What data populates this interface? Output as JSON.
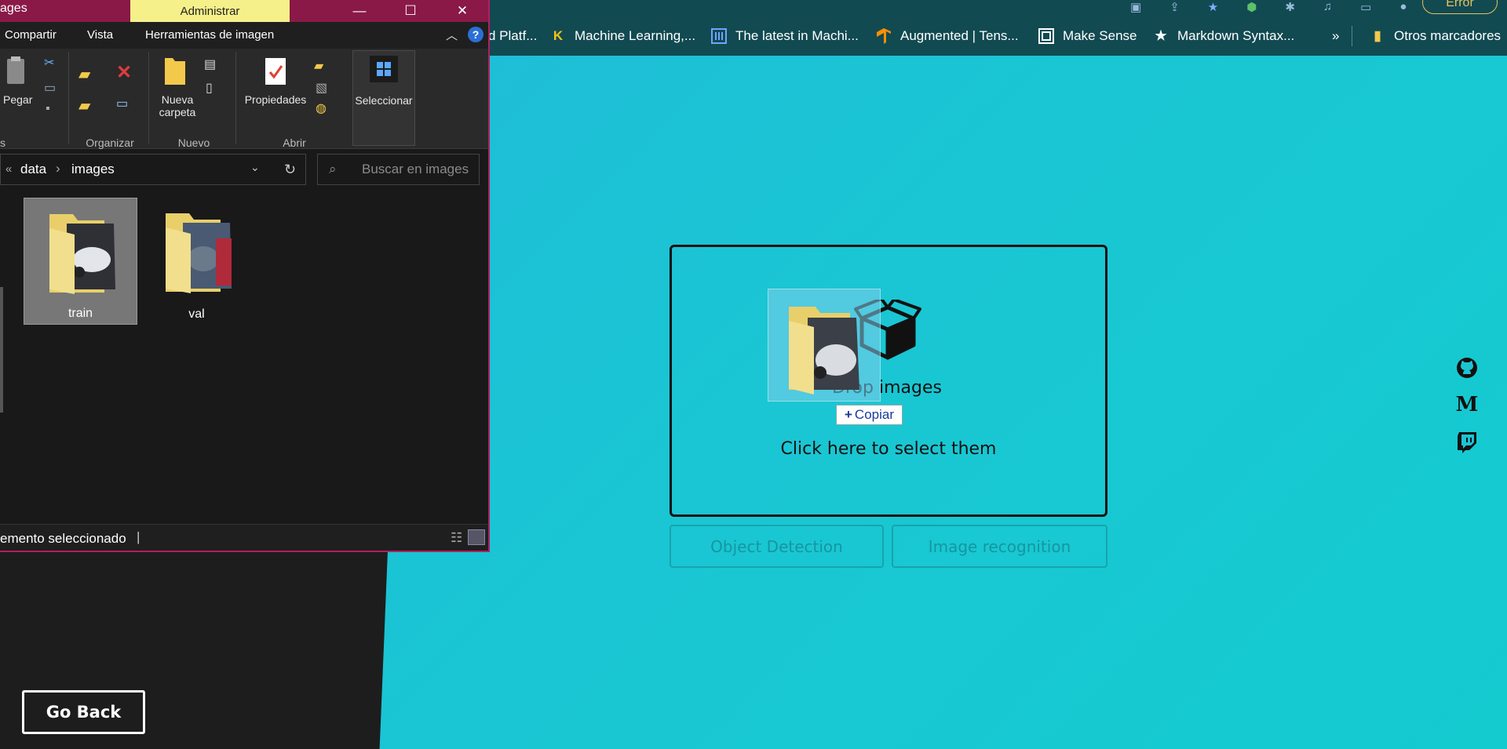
{
  "explorer": {
    "title": "ages",
    "context_tab": "Administrar",
    "window_buttons": {
      "minimize": "—",
      "maximize": "☐",
      "close": "✕"
    },
    "tabs": [
      "Compartir",
      "Vista",
      "Herramientas de imagen"
    ],
    "help": "?",
    "ribbon": {
      "paste_label": "Pegar",
      "new_folder_label": "Nueva carpeta",
      "properties_label": "Propiedades",
      "select_label": "Seleccionar",
      "groups": [
        "s",
        "Organizar",
        "Nuevo",
        "Abrir"
      ]
    },
    "address": {
      "prefix": "«",
      "crumbs": [
        "data",
        "images"
      ],
      "sep": "›"
    },
    "search_placeholder": "Buscar en images",
    "folders": [
      {
        "name": "train",
        "selected": true
      },
      {
        "name": "val",
        "selected": false
      }
    ],
    "status_text": "emento seleccionado"
  },
  "browser": {
    "bookmarks": [
      {
        "label": "d Platf...",
        "icon": "none"
      },
      {
        "label": "Machine Learning,...",
        "icon": "kaggle-k-icon"
      },
      {
        "label": "The latest in Machi...",
        "icon": "paperswithcode-icon"
      },
      {
        "label": "Augmented | Tens...",
        "icon": "tensorflow-icon"
      },
      {
        "label": "Make Sense",
        "icon": "makesense-icon"
      },
      {
        "label": "Markdown Syntax...",
        "icon": "star-icon"
      }
    ],
    "overflow": "»",
    "other_bookmarks": "Otros marcadores",
    "error_chip": "Error"
  },
  "dropzone": {
    "title": "Drop images",
    "subtitle": "Click here to select them"
  },
  "drag": {
    "copy_label": "Copiar",
    "copy_symbol": "+"
  },
  "modes": {
    "object_detection": "Object Detection",
    "image_recognition": "Image recognition"
  },
  "social": [
    "github-icon",
    "medium-icon",
    "twitch-icon"
  ],
  "medium_letter": "M",
  "go_back": "Go Back"
}
